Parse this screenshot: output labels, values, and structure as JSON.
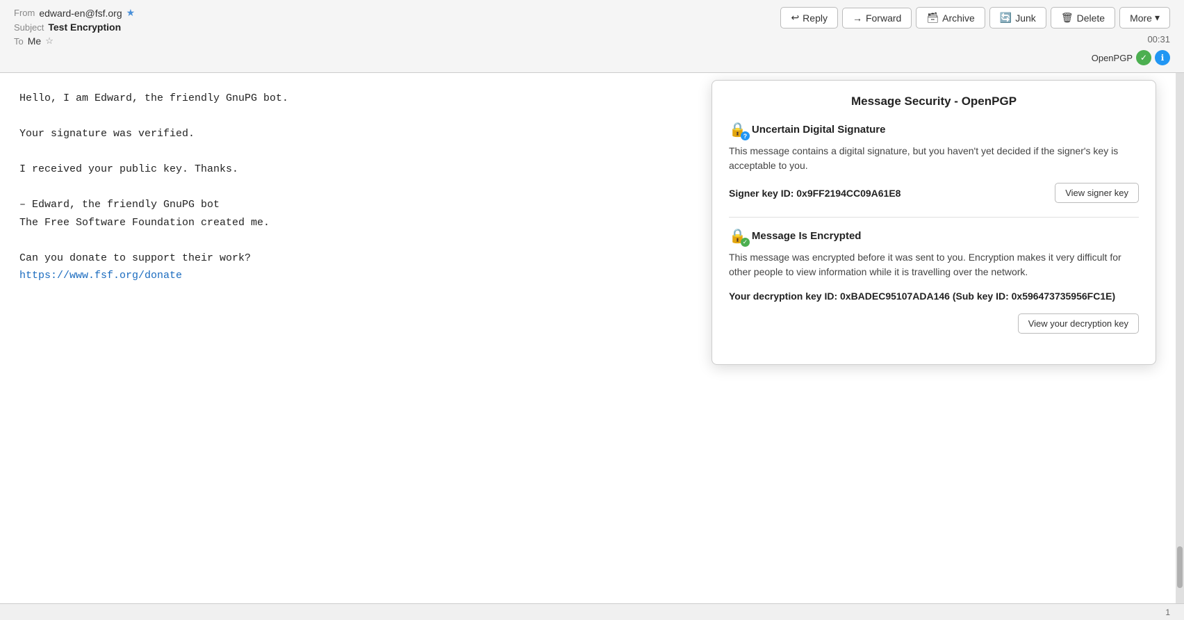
{
  "header": {
    "from_label": "From",
    "from_email": "edward-en@fsf.org",
    "subject_label": "Subject",
    "subject_text": "Test Encryption",
    "to_label": "To",
    "to_name": "Me",
    "time": "00:31",
    "openpgp_label": "OpenPGP"
  },
  "toolbar": {
    "reply_label": "Reply",
    "forward_label": "Forward",
    "archive_label": "Archive",
    "junk_label": "Junk",
    "delete_label": "Delete",
    "more_label": "More"
  },
  "email_body": {
    "line1": "Hello, I am Edward, the friendly GnuPG bot.",
    "line2": "Your signature was verified.",
    "line3": "I received your public key. Thanks.",
    "line4": "– Edward, the friendly GnuPG bot",
    "line5": "The Free Software Foundation created me.",
    "line6": "Can you donate to support their work?",
    "link_text": "https://www.fsf.org/donate",
    "link_url": "https://www.fsf.org/donate"
  },
  "security_panel": {
    "title": "Message Security - OpenPGP",
    "signature_section": {
      "title": "Uncertain Digital Signature",
      "body": "This message contains a digital signature, but you haven't yet decided if the signer's key is acceptable to you.",
      "key_id_label": "Signer key ID: 0x9FF2194CC09A61E8",
      "view_btn_label": "View signer key"
    },
    "encryption_section": {
      "title": "Message Is Encrypted",
      "body": "This message was encrypted before it was sent to you. Encryption makes it very difficult for other people to view information while it is travelling over the network.",
      "decryption_key_id": "Your decryption key ID: 0xBADEC95107ADA146 (Sub key ID: 0x596473735956FC1E)",
      "view_btn_label": "View your decryption key"
    }
  },
  "bottom": {
    "page_num": "1"
  }
}
